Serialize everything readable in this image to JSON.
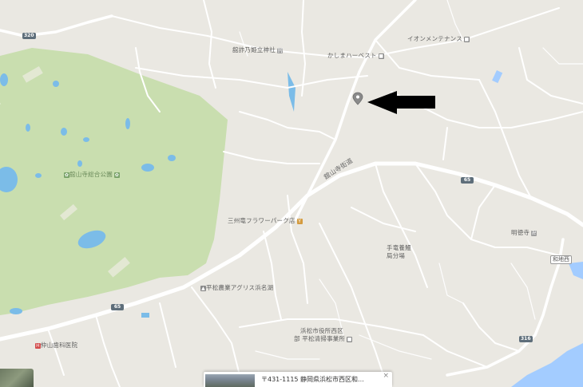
{
  "map": {
    "road_shields": {
      "route_320": "320",
      "route_65_west": "65",
      "route_65_east": "65",
      "route_316": "316"
    },
    "labels": {
      "shrine": "舘詐乃姫立神社",
      "supermarket": "かしまハーベスト",
      "maintenance": "イオンメンテナンス",
      "park": "舘山寺総合公園",
      "kanzanji_road": "舘山寺街道",
      "flower_park": "三州竜フラワーパーク店",
      "fishing_port": "手竜養鰻",
      "fishing_port_2": "局分場",
      "temple": "明徳寺",
      "station": "和地西",
      "agris": "平松農業アグリス浜名湖",
      "city_office": "浜松市役所西区",
      "city_office_2": "部 平松清掃事業所",
      "dental": "仲山歯科医院"
    }
  },
  "info_card": {
    "address": "〒431-1115 静岡県浜松市西区和...",
    "close": "×"
  },
  "icons": {
    "marker": "location-pin-icon",
    "arrow": "black-arrow-icon"
  },
  "colors": {
    "land": "#eae8e2",
    "park": "#c9deaf",
    "water": "#7bbce8",
    "road": "#ffffff",
    "sea": "#a3ccff"
  }
}
